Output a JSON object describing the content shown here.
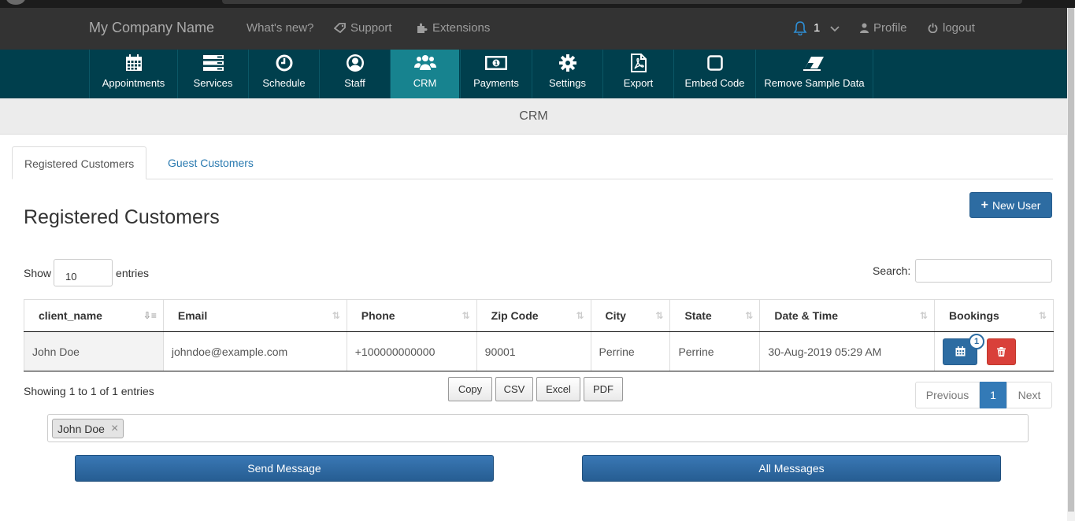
{
  "topbar": {
    "brand": "My Company Name",
    "links": [
      "What's new?",
      "Support",
      "Extensions"
    ],
    "notifications_count": "1",
    "profile": "Profile",
    "logout": "logout"
  },
  "iconnav": {
    "items": [
      {
        "label": "Appointments",
        "icon": "calendar-icon"
      },
      {
        "label": "Services",
        "icon": "list-icon"
      },
      {
        "label": "Schedule",
        "icon": "clock-icon"
      },
      {
        "label": "Staff",
        "icon": "user-circle-icon"
      },
      {
        "label": "CRM",
        "icon": "users-icon",
        "active": true
      },
      {
        "label": "Payments",
        "icon": "money-icon"
      },
      {
        "label": "Settings",
        "icon": "gear-icon"
      },
      {
        "label": "Export",
        "icon": "pdf-file-icon"
      },
      {
        "label": "Embed Code",
        "icon": "square-icon"
      },
      {
        "label": "Remove Sample Data",
        "icon": "eraser-icon"
      }
    ]
  },
  "section_title": "CRM",
  "tabs": [
    "Registered Customers",
    "Guest Customers"
  ],
  "page_title": "Registered Customers",
  "new_user_label": "New User",
  "show": {
    "prefix": "Show",
    "value": "10",
    "suffix": "entries"
  },
  "search_label": "Search:",
  "table": {
    "columns": [
      "client_name",
      "Email",
      "Phone",
      "Zip Code",
      "City",
      "State",
      "Date & Time",
      "Bookings"
    ],
    "rows": [
      {
        "client_name": "John Doe",
        "email": "johndoe@example.com",
        "phone": "+100000000000",
        "zip": "90001",
        "city": "Perrine",
        "state": "Perrine",
        "datetime": "30-Aug-2019 05:29 AM",
        "bookings_badge": "1"
      }
    ]
  },
  "info": "Showing 1 to 1 of 1 entries",
  "exports": [
    "Copy",
    "CSV",
    "Excel",
    "PDF"
  ],
  "pager": {
    "prev": "Previous",
    "current": "1",
    "next": "Next"
  },
  "recipient_chip": "John Doe",
  "send_message": "Send Message",
  "all_messages": "All Messages",
  "colors": {
    "topbar": "#333333",
    "iconnav": "#003f4d",
    "active_tile": "#17838f",
    "primary": "#2d6ca2",
    "danger": "#d9403a"
  }
}
